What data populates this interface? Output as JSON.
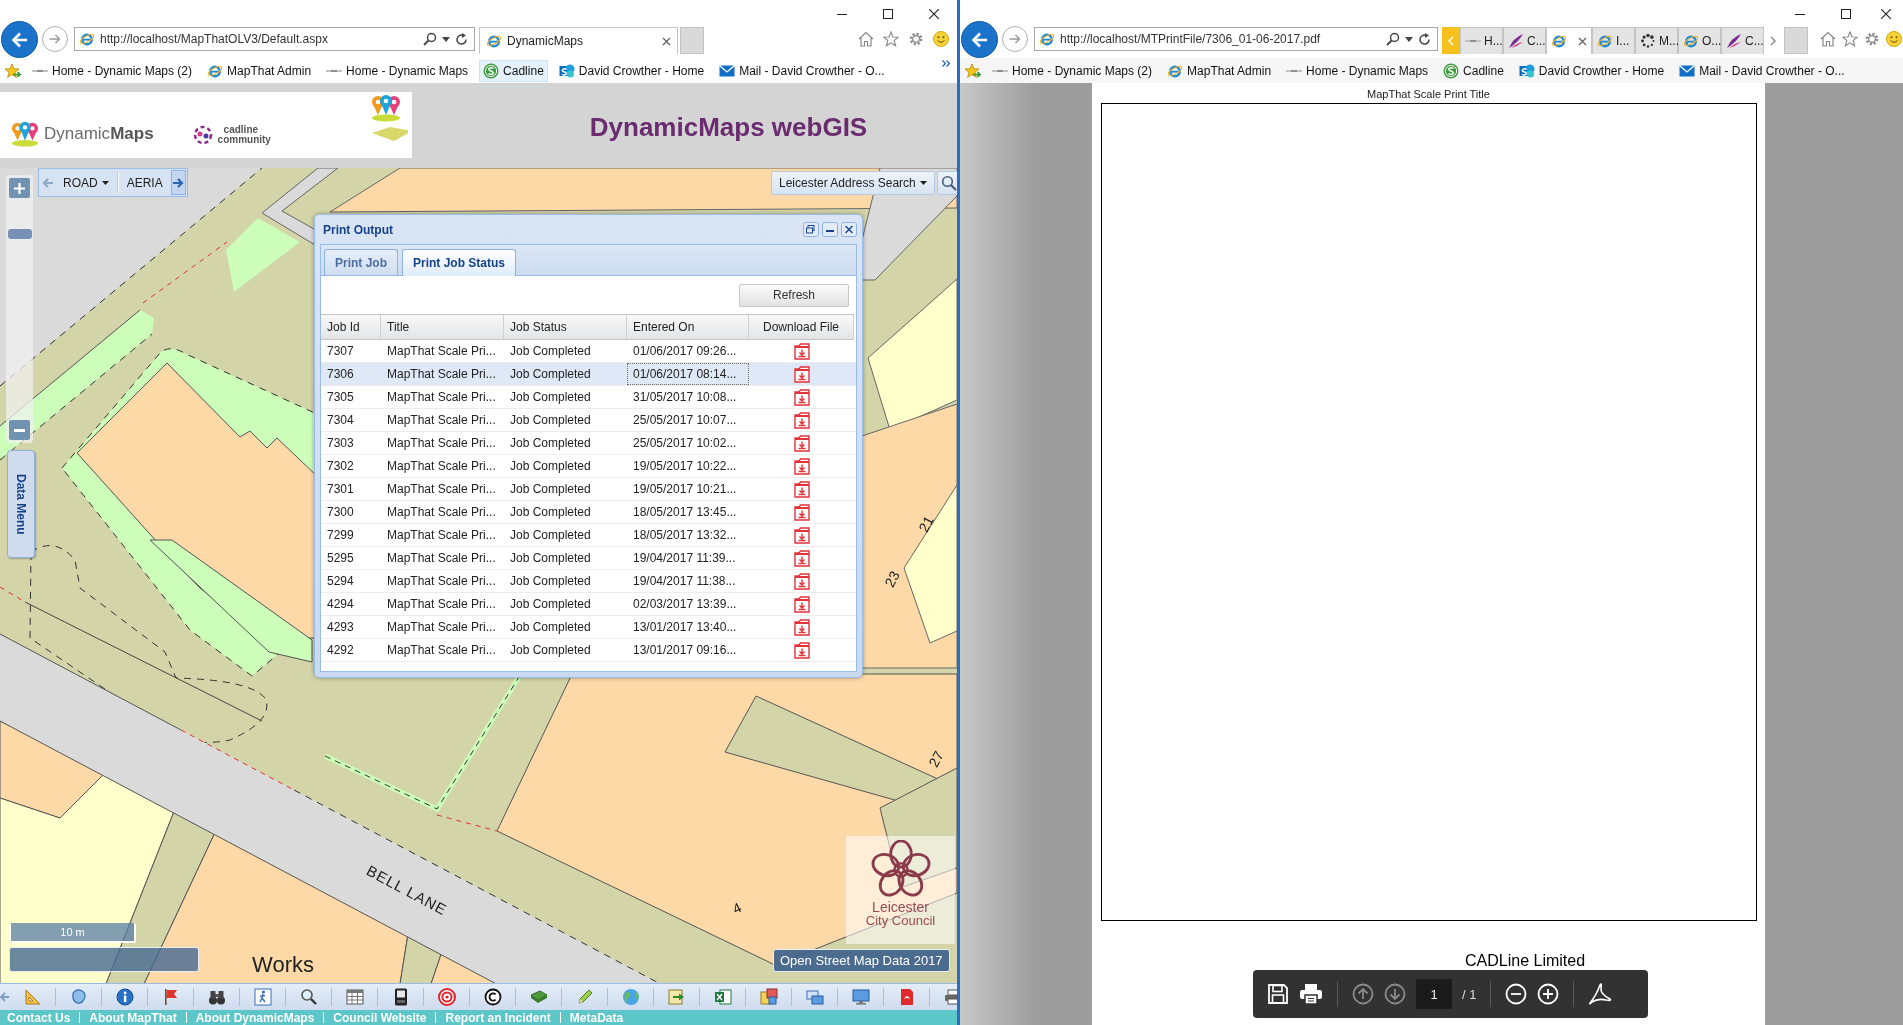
{
  "left_window": {
    "address": "http://localhost/MapThatOLV3/Default.aspx",
    "tabs": [
      {
        "label": "DynamicMaps",
        "kind": "ie",
        "selected": true
      }
    ],
    "favorites": [
      {
        "label": "Home - Dynamic Maps (2)",
        "kind": "page",
        "hovered": false
      },
      {
        "label": "MapThat Admin",
        "kind": "ie",
        "hovered": false
      },
      {
        "label": "Home - Dynamic Maps",
        "kind": "page",
        "hovered": false
      },
      {
        "label": "Cadline",
        "kind": "cadline",
        "hovered": true
      },
      {
        "label": "David Crowther - Home",
        "kind": "sharepoint",
        "hovered": false
      },
      {
        "label": "Mail - David Crowther - O...",
        "kind": "mail",
        "hovered": false
      }
    ]
  },
  "app_header": {
    "logo_text": "Dynamic**Maps**",
    "community_logo": [
      "cadline",
      "community"
    ],
    "title": "DynamicMaps webGIS"
  },
  "map": {
    "layers": [
      {
        "label": "ROAD",
        "kind": "menu"
      },
      {
        "label": "AERIA",
        "kind": "plain"
      }
    ],
    "search": "Leicester Address Search",
    "zoom": {
      "level": 0.86
    },
    "side_tab": "Data Menu",
    "labels": [
      "BELL LANE",
      "Works",
      "4",
      "21",
      "23",
      "27"
    ],
    "scale": "10 m",
    "attribution": "Open Street Map Data 2017",
    "council_logo": [
      "Leicester",
      "City Council"
    ]
  },
  "print_dialog": {
    "title": "Print Output",
    "tabs": [
      {
        "label": "Print Job",
        "selected": false
      },
      {
        "label": "Print Job Status",
        "selected": true
      }
    ],
    "refresh": "Refresh",
    "columns": [
      "Job Id",
      "Title",
      "Job Status",
      "Entered On",
      "Download File"
    ],
    "rows": [
      {
        "job_id": "7307",
        "title": "MapThat Scale Pri...",
        "status": "Job Completed",
        "entered_on": "01/06/2017 09:26...",
        "selected": false
      },
      {
        "job_id": "7306",
        "title": "MapThat Scale Pri...",
        "status": "Job Completed",
        "entered_on": "01/06/2017 08:14...",
        "selected": true
      },
      {
        "job_id": "7305",
        "title": "MapThat Scale Pri...",
        "status": "Job Completed",
        "entered_on": "31/05/2017 10:08...",
        "selected": false
      },
      {
        "job_id": "7304",
        "title": "MapThat Scale Pri...",
        "status": "Job Completed",
        "entered_on": "25/05/2017 10:07...",
        "selected": false
      },
      {
        "job_id": "7303",
        "title": "MapThat Scale Pri...",
        "status": "Job Completed",
        "entered_on": "25/05/2017 10:02...",
        "selected": false
      },
      {
        "job_id": "7302",
        "title": "MapThat Scale Pri...",
        "status": "Job Completed",
        "entered_on": "19/05/2017 10:22...",
        "selected": false
      },
      {
        "job_id": "7301",
        "title": "MapThat Scale Pri...",
        "status": "Job Completed",
        "entered_on": "19/05/2017 10:21...",
        "selected": false
      },
      {
        "job_id": "7300",
        "title": "MapThat Scale Pri...",
        "status": "Job Completed",
        "entered_on": "18/05/2017 13:45...",
        "selected": false
      },
      {
        "job_id": "7299",
        "title": "MapThat Scale Pri...",
        "status": "Job Completed",
        "entered_on": "18/05/2017 13:32...",
        "selected": false
      },
      {
        "job_id": "5295",
        "title": "MapThat Scale Pri...",
        "status": "Job Completed",
        "entered_on": "19/04/2017 11:39...",
        "selected": false
      },
      {
        "job_id": "5294",
        "title": "MapThat Scale Pri...",
        "status": "Job Completed",
        "entered_on": "19/04/2017 11:38...",
        "selected": false
      },
      {
        "job_id": "4294",
        "title": "MapThat Scale Pri...",
        "status": "Job Completed",
        "entered_on": "02/03/2017 13:39...",
        "selected": false
      },
      {
        "job_id": "4293",
        "title": "MapThat Scale Pri...",
        "status": "Job Completed",
        "entered_on": "13/01/2017 13:40...",
        "selected": false
      },
      {
        "job_id": "4292",
        "title": "MapThat Scale Pri...",
        "status": "Job Completed",
        "entered_on": "13/01/2017 09:16...",
        "selected": false
      }
    ]
  },
  "footer_links": [
    "Contact Us",
    "About MapThat",
    "About DynamicMaps",
    "Council Website",
    "Report an Incident",
    "MetaData"
  ],
  "right_window": {
    "address": "http://localhost/MTPrintFile/7306_01-06-2017.pdf",
    "tabs": [
      {
        "label": "H...",
        "kind": "page",
        "selected": false
      },
      {
        "label": "C...",
        "kind": "feather",
        "selected": false
      },
      {
        "kind": "ie",
        "selected": true
      },
      {
        "label": "I...",
        "kind": "ie",
        "selected": false
      },
      {
        "label": "M...",
        "kind": "dots",
        "selected": false
      },
      {
        "label": "O...",
        "kind": "ie",
        "selected": false
      },
      {
        "label": "C...",
        "kind": "feather",
        "selected": false
      }
    ],
    "favorites": [
      {
        "label": "Home - Dynamic Maps (2)",
        "kind": "page",
        "hovered": false
      },
      {
        "label": "MapThat Admin",
        "kind": "ie",
        "hovered": false
      },
      {
        "label": "Home - Dynamic Maps",
        "kind": "page",
        "hovered": false
      },
      {
        "label": "Cadline",
        "kind": "cadline",
        "hovered": false
      },
      {
        "label": "David Crowther - Home",
        "kind": "sharepoint",
        "hovered": false
      },
      {
        "label": "Mail - David Crowther - O...",
        "kind": "mail",
        "hovered": false
      }
    ]
  },
  "pdf": {
    "title": "MapThat Scale Print Title",
    "footer": "CADLine Limited",
    "page": "1",
    "page_count": "/ 1"
  }
}
